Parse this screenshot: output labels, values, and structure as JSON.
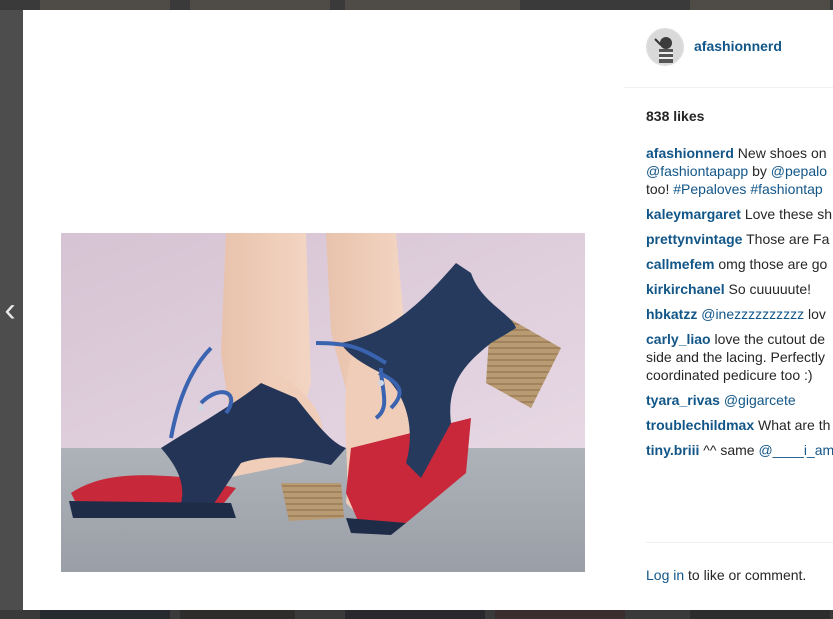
{
  "navigation": {
    "prev_arrow": "‹"
  },
  "post": {
    "username": "afashionnerd",
    "likes": "838 likes",
    "caption": {
      "user": "afashionnerd",
      "line1_text": " New shoes on",
      "line2_link1": "@fashiontapapp",
      "line2_text": " by ",
      "line2_link2": "@pepalo",
      "line3_text": "too! ",
      "line3_tag1": "#Pepaloves",
      "line3_space": " ",
      "line3_tag2": "#fashiontap"
    },
    "comments": [
      {
        "user": "kaleymargaret",
        "text": " Love these sh"
      },
      {
        "user": "prettynvintage",
        "text": " Those are Fa"
      },
      {
        "user": "callmefem",
        "text": " omg those are go"
      },
      {
        "user": "kirkirchanel",
        "text": " So cuuuuute!"
      },
      {
        "user": "hbkatzz",
        "mention": "@inezzzzzzzzzz",
        "text": " lov"
      },
      {
        "user": "carly_liao",
        "text": " love the cutout de",
        "line2": "side and the lacing. Perfectly",
        "line3": "coordinated pedicure too :)"
      },
      {
        "user": "tyara_rivas",
        "mention": "@gigarcete",
        "text": ""
      },
      {
        "user": "troublechildmax",
        "text": " What are th"
      },
      {
        "user": "tiny.briii",
        "text": " ^^ same ",
        "mention_after": "@____i_am_"
      }
    ],
    "footer": {
      "login_link": "Log in",
      "login_text": " to like or comment."
    }
  },
  "colors": {
    "link": "#125688",
    "text": "#262626",
    "backdrop": "#4d4d4d"
  },
  "icons": {
    "prev": "chevron-left-icon"
  }
}
